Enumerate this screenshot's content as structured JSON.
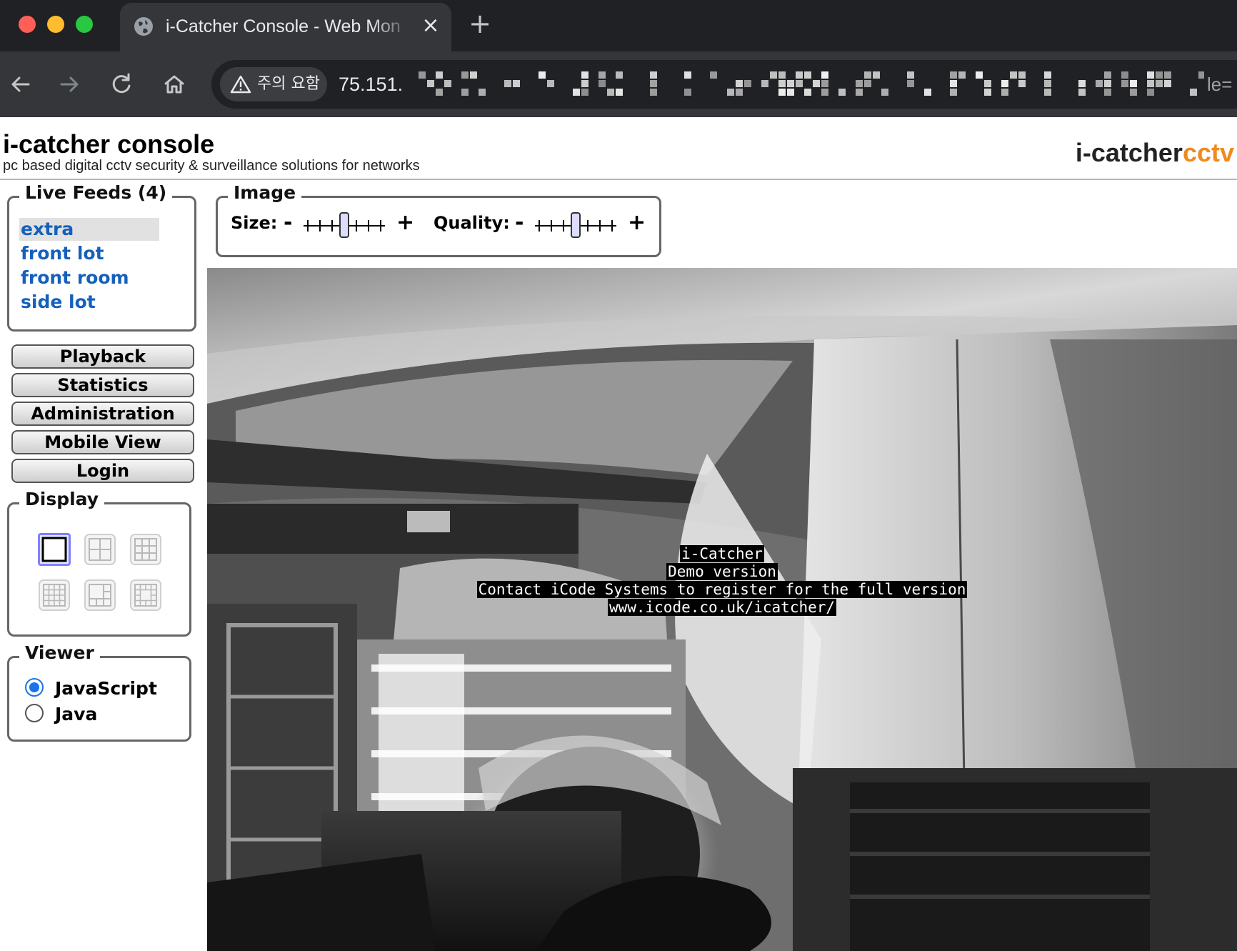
{
  "browser": {
    "tab_title": "i-Catcher Console - Web Mon",
    "tab_close": "×",
    "new_tab": "+",
    "security_label": "주의 요함",
    "url_visible": "75.151.",
    "url_tail": "le="
  },
  "header": {
    "title": "i-catcher console",
    "tagline": "pc based digital cctv security & surveillance solutions for networks",
    "logo_part1": "i-catcher",
    "logo_part2": "cctv",
    "logo_accent_color": "#f08a1c"
  },
  "live_feeds": {
    "legend": "Live Feeds (4)",
    "items": [
      {
        "label": "extra",
        "selected": true
      },
      {
        "label": "front lot",
        "selected": false
      },
      {
        "label": "front room",
        "selected": false
      },
      {
        "label": "side lot",
        "selected": false
      }
    ],
    "link_color": "#1560bd"
  },
  "nav_buttons": [
    "Playback",
    "Statistics",
    "Administration",
    "Mobile View",
    "Login"
  ],
  "display": {
    "legend": "Display",
    "layouts": [
      "single-view-icon",
      "quad-view-icon",
      "3x3-grid-icon",
      "4x4-grid-icon",
      "1-plus-5-view-icon",
      "1-plus-12-view-icon"
    ],
    "selected_layout": "single-view-icon"
  },
  "viewer": {
    "legend": "Viewer",
    "options": [
      {
        "label": "JavaScript",
        "checked": true
      },
      {
        "label": "Java",
        "checked": false
      }
    ]
  },
  "image_controls": {
    "legend": "Image",
    "size_label": "Size:",
    "quality_label": "Quality:",
    "minus": "-",
    "plus": "+",
    "size_level_step": 3,
    "quality_level_step": 3,
    "steps_total": 7
  },
  "camera": {
    "overlay_lines": [
      "i-Catcher",
      "Demo version",
      "Contact iCode Systems to register for the full version",
      "www.icode.co.uk/icatcher/"
    ]
  }
}
